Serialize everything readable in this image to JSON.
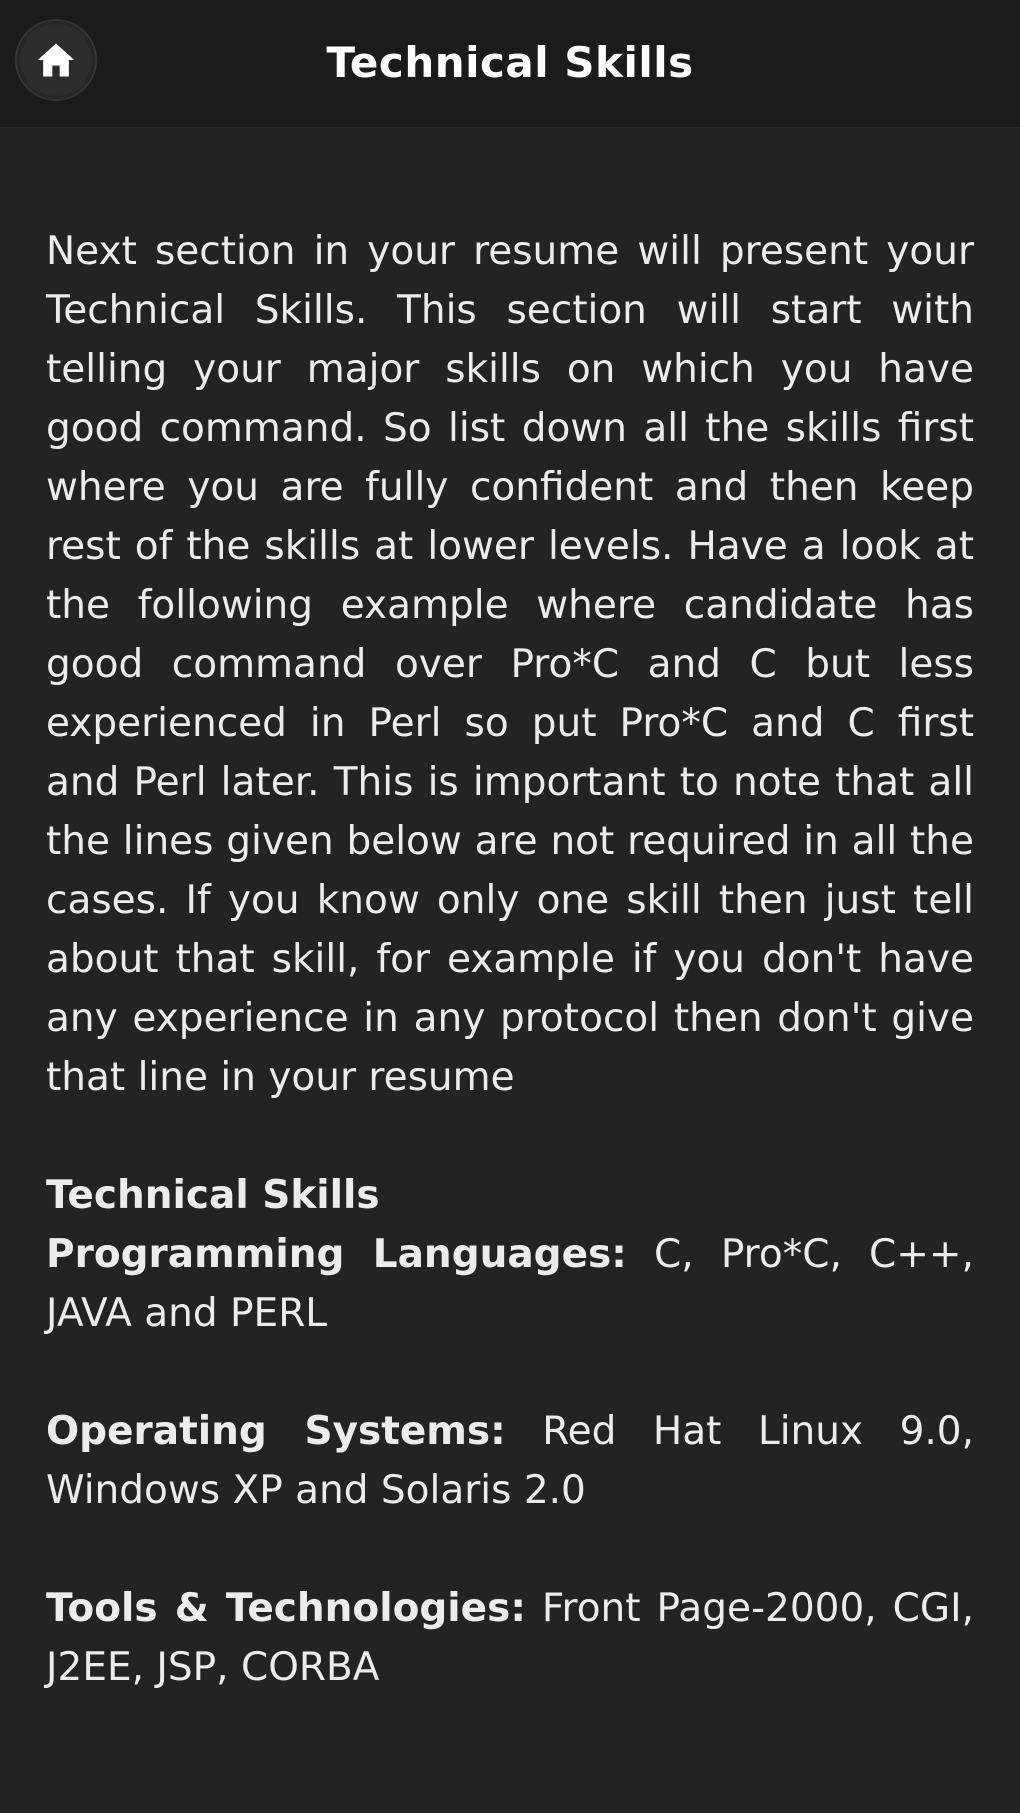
{
  "header": {
    "title": "Technical Skills",
    "home_icon": "home-icon"
  },
  "content": {
    "intro": "Next section in your resume will present your Technical Skills. This section will start with telling your major skills on which you have good command. So list down all the skills first where you are fully confident and then keep rest of the skills at lower levels. Have a look at the following example where candidate has good command over Pro*C and C but less experienced in Perl so put Pro*C and C first and Perl later. This is important to note that all the lines given below are not required in all the cases. If you know only one skill then just tell about that skill, for example if you don't have any experience in any protocol then don't give that line in your resume",
    "skills_heading": "Technical Skills",
    "skills": [
      {
        "label": "Programming Languages:",
        "value": "C, Pro*C, C++, JAVA and PERL"
      },
      {
        "label": "Operating Systems:",
        "value": "Red Hat Linux 9.0, Windows XP and Solaris 2.0"
      },
      {
        "label": "Tools & Technologies:",
        "value": "Front Page-2000, CGI, J2EE, JSP, CORBA"
      }
    ]
  },
  "colors": {
    "background": "#232323",
    "header_background": "#1b1b1b",
    "text": "#ececec"
  }
}
